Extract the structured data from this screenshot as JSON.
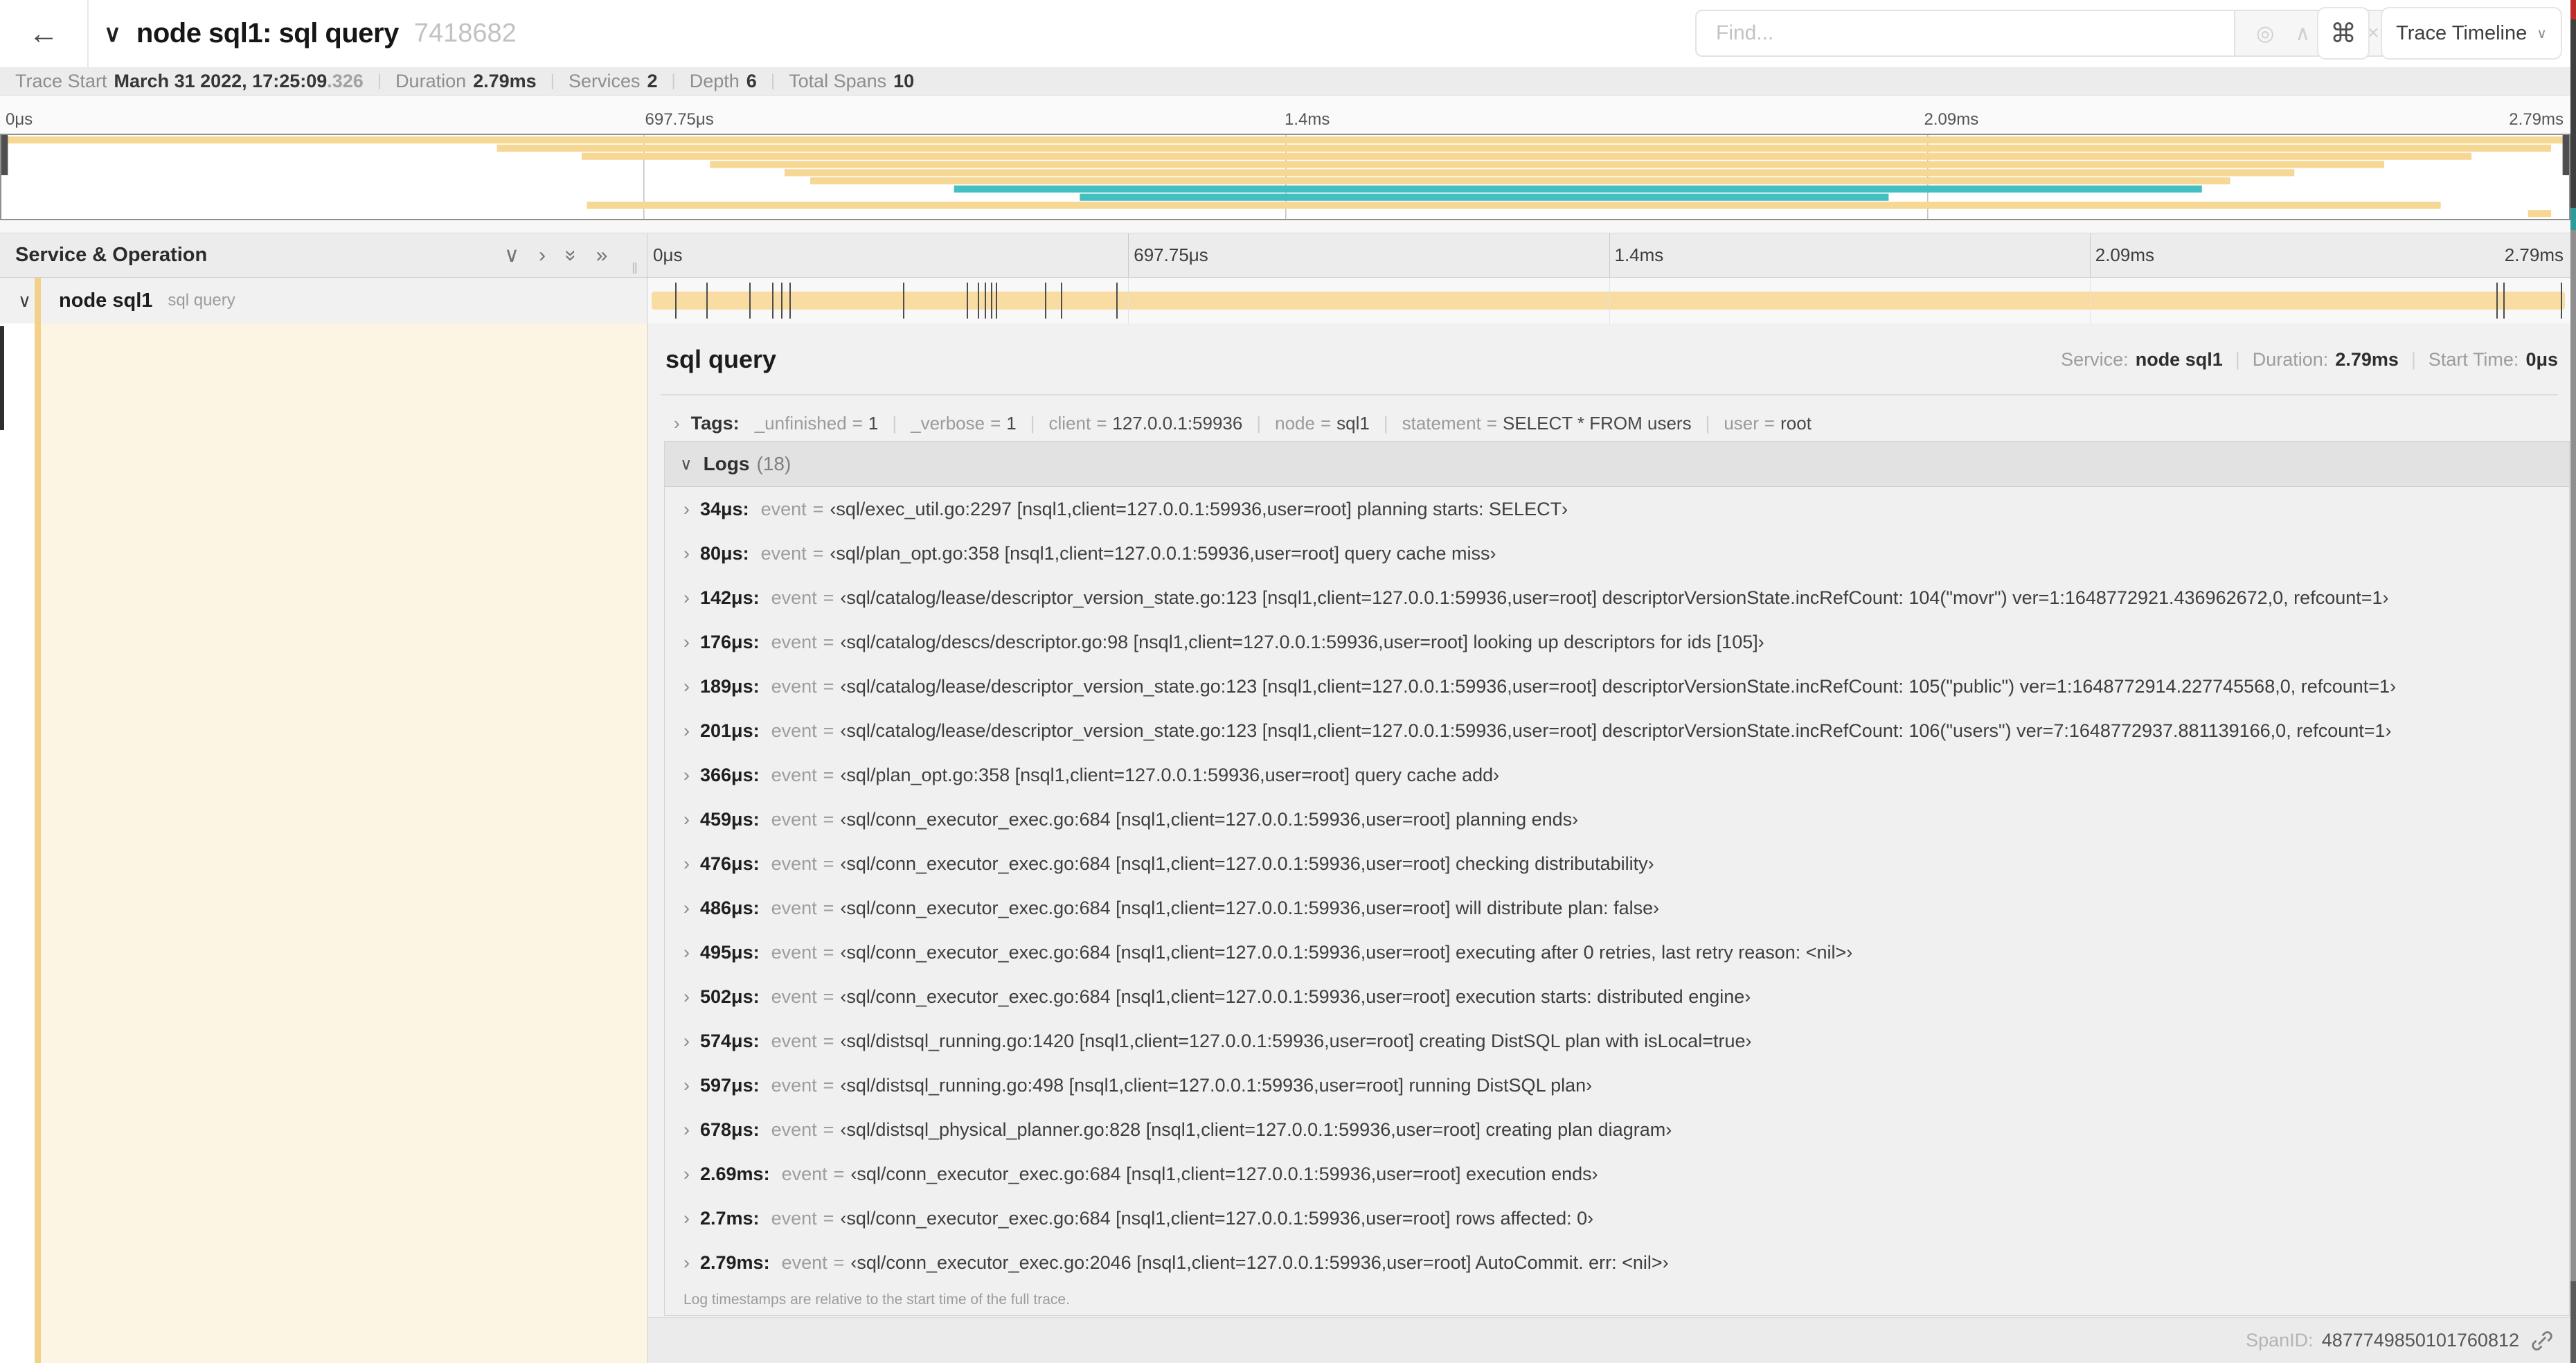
{
  "colors": {
    "span_tan": "#F8DCA1",
    "span_teal": "#44BFBF",
    "accent_stripe": "#F3D18A",
    "selected_cream": "#FCF5E4",
    "edge_red": "#BF2B2B",
    "edge_teal": "#2F9C9C"
  },
  "header": {
    "back_icon": "←",
    "collapse_icon": "∨",
    "title": "node sql1: sql query",
    "trace_id": "7418682",
    "find_placeholder": "Find...",
    "find_icons": [
      "locate",
      "prev",
      "next",
      "clear"
    ],
    "kbd_icon": "⌘",
    "trace_timeline_label": "Trace Timeline"
  },
  "stats": [
    {
      "label": "Trace Start",
      "value": "March 31 2022, 17:25:09",
      "suffix": ".326"
    },
    {
      "label": "Duration",
      "value": "2.79ms",
      "suffix": ""
    },
    {
      "label": "Services",
      "value": "2",
      "suffix": ""
    },
    {
      "label": "Depth",
      "value": "6",
      "suffix": ""
    },
    {
      "label": "Total Spans",
      "value": "10",
      "suffix": ""
    }
  ],
  "ticks": [
    "0μs",
    "697.75μs",
    "1.4ms",
    "2.09ms",
    "2.79ms"
  ],
  "minimap": {
    "spans": [
      {
        "s": 0.0,
        "e": 1.0,
        "c": "tan"
      },
      {
        "s": 0.193,
        "e": 0.993,
        "c": "tan"
      },
      {
        "s": 0.226,
        "e": 0.962,
        "c": "tan"
      },
      {
        "s": 0.276,
        "e": 0.928,
        "c": "tan"
      },
      {
        "s": 0.305,
        "e": 0.893,
        "c": "tan"
      },
      {
        "s": 0.315,
        "e": 0.868,
        "c": "tan"
      },
      {
        "s": 0.371,
        "e": 0.857,
        "c": "teal"
      },
      {
        "s": 0.42,
        "e": 0.735,
        "c": "teal"
      },
      {
        "s": 0.228,
        "e": 0.95,
        "c": "tan"
      },
      {
        "s": 0.984,
        "e": 0.993,
        "c": "tan"
      }
    ]
  },
  "list_header": {
    "title": "Service & Operation",
    "grip": "‖"
  },
  "span_row": {
    "service": "node sql1",
    "operation": "sql query",
    "marker_fractions": [
      0.0122,
      0.0287,
      0.0509,
      0.0631,
      0.0677,
      0.072,
      0.1312,
      0.1645,
      0.1706,
      0.1742,
      0.1774,
      0.18,
      0.2057,
      0.214,
      0.243,
      0.9642,
      0.9677,
      0.998
    ]
  },
  "detail": {
    "title": "sql query",
    "meta": [
      {
        "label": "Service:",
        "value": "node sql1"
      },
      {
        "label": "Duration:",
        "value": "2.79ms"
      },
      {
        "label": "Start Time:",
        "value": "0μs"
      }
    ],
    "tags_label": "Tags:",
    "tags": [
      {
        "key": "_unfinished",
        "value": "1"
      },
      {
        "key": "_verbose",
        "value": "1"
      },
      {
        "key": "client",
        "value": "127.0.0.1:59936"
      },
      {
        "key": "node",
        "value": "sql1"
      },
      {
        "key": "statement",
        "value": "SELECT * FROM users"
      },
      {
        "key": "user",
        "value": "root"
      }
    ],
    "logs_label": "Logs",
    "logs_count": "(18)",
    "event_label": "event",
    "logs": [
      {
        "t": "34μs:",
        "v": "‹sql/exec_util.go:2297 [nsql1,client=127.0.0.1:59936,user=root] planning starts: SELECT›"
      },
      {
        "t": "80μs:",
        "v": "‹sql/plan_opt.go:358 [nsql1,client=127.0.0.1:59936,user=root] query cache miss›"
      },
      {
        "t": "142μs:",
        "v": "‹sql/catalog/lease/descriptor_version_state.go:123 [nsql1,client=127.0.0.1:59936,user=root] descriptorVersionState.incRefCount: 104(\"movr\") ver=1:1648772921.436962672,0, refcount=1›"
      },
      {
        "t": "176μs:",
        "v": "‹sql/catalog/descs/descriptor.go:98 [nsql1,client=127.0.0.1:59936,user=root] looking up descriptors for ids [105]›"
      },
      {
        "t": "189μs:",
        "v": "‹sql/catalog/lease/descriptor_version_state.go:123 [nsql1,client=127.0.0.1:59936,user=root] descriptorVersionState.incRefCount: 105(\"public\") ver=1:1648772914.227745568,0, refcount=1›"
      },
      {
        "t": "201μs:",
        "v": "‹sql/catalog/lease/descriptor_version_state.go:123 [nsql1,client=127.0.0.1:59936,user=root] descriptorVersionState.incRefCount: 106(\"users\") ver=7:1648772937.881139166,0, refcount=1›"
      },
      {
        "t": "366μs:",
        "v": "‹sql/plan_opt.go:358 [nsql1,client=127.0.0.1:59936,user=root] query cache add›"
      },
      {
        "t": "459μs:",
        "v": "‹sql/conn_executor_exec.go:684 [nsql1,client=127.0.0.1:59936,user=root] planning ends›"
      },
      {
        "t": "476μs:",
        "v": "‹sql/conn_executor_exec.go:684 [nsql1,client=127.0.0.1:59936,user=root] checking distributability›"
      },
      {
        "t": "486μs:",
        "v": "‹sql/conn_executor_exec.go:684 [nsql1,client=127.0.0.1:59936,user=root] will distribute plan: false›"
      },
      {
        "t": "495μs:",
        "v": "‹sql/conn_executor_exec.go:684 [nsql1,client=127.0.0.1:59936,user=root] executing after 0 retries, last retry reason: <nil>›"
      },
      {
        "t": "502μs:",
        "v": "‹sql/conn_executor_exec.go:684 [nsql1,client=127.0.0.1:59936,user=root] execution starts: distributed engine›"
      },
      {
        "t": "574μs:",
        "v": "‹sql/distsql_running.go:1420 [nsql1,client=127.0.0.1:59936,user=root] creating DistSQL plan with isLocal=true›"
      },
      {
        "t": "597μs:",
        "v": "‹sql/distsql_running.go:498 [nsql1,client=127.0.0.1:59936,user=root] running DistSQL plan›"
      },
      {
        "t": "678μs:",
        "v": "‹sql/distsql_physical_planner.go:828 [nsql1,client=127.0.0.1:59936,user=root] creating plan diagram›"
      },
      {
        "t": "2.69ms:",
        "v": "‹sql/conn_executor_exec.go:684 [nsql1,client=127.0.0.1:59936,user=root] execution ends›"
      },
      {
        "t": "2.7ms:",
        "v": "‹sql/conn_executor_exec.go:684 [nsql1,client=127.0.0.1:59936,user=root] rows affected: 0›"
      },
      {
        "t": "2.79ms:",
        "v": "‹sql/conn_executor_exec.go:2046 [nsql1,client=127.0.0.1:59936,user=root] AutoCommit. err: <nil>›"
      }
    ],
    "footer_note": "Log timestamps are relative to the start time of the full trace.",
    "span_id_label": "SpanID:",
    "span_id": "4877749850101760812"
  }
}
